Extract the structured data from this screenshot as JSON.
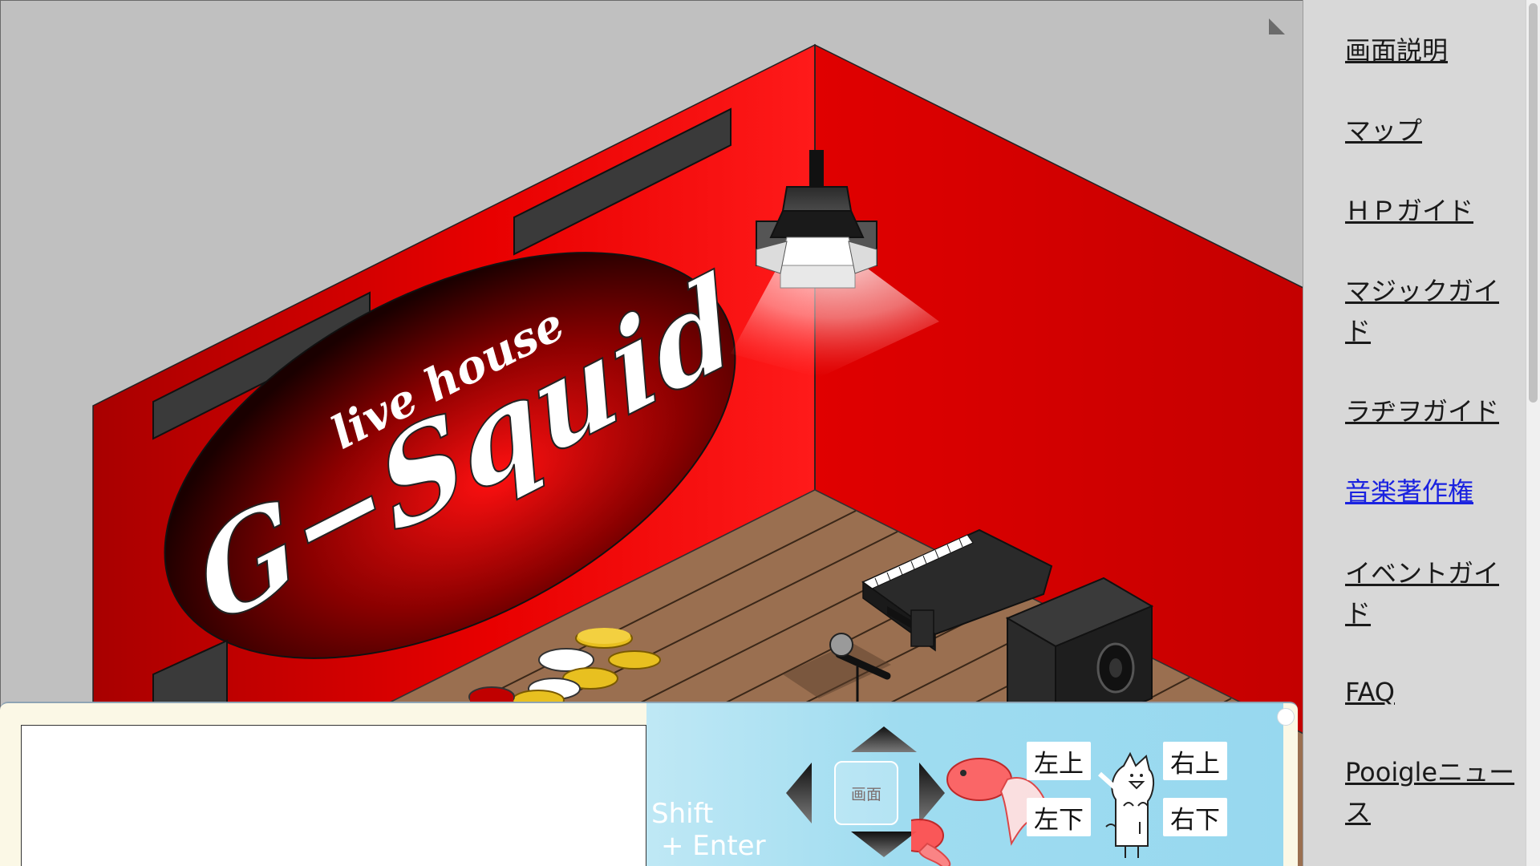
{
  "scene": {
    "sign_small": "live house",
    "sign_big": "G−Squid"
  },
  "sidebar": {
    "items": [
      {
        "label": "画面説明"
      },
      {
        "label": "マップ"
      },
      {
        "label": "ＨＰガイド"
      },
      {
        "label": "マジックガイド"
      },
      {
        "label": "ラヂヲガイド"
      },
      {
        "label": "音楽著作権"
      },
      {
        "label": "イベントガイド"
      },
      {
        "label": "FAQ"
      },
      {
        "label": "Pooigleニュース"
      }
    ]
  },
  "chat": {
    "value": "",
    "send_hint_line1": "Shift",
    "send_hint_line2": "+ Enter"
  },
  "controls": {
    "screen_button_label": "画面",
    "dir_upper_left": "左上",
    "dir_upper_right": "右上",
    "dir_lower_left": "左下",
    "dir_lower_right": "右下"
  },
  "colors": {
    "wall": "#e00000",
    "floor": "#9a6f50",
    "panel_blue": "#9fdcf0",
    "visited_link": "#1a22e0"
  }
}
